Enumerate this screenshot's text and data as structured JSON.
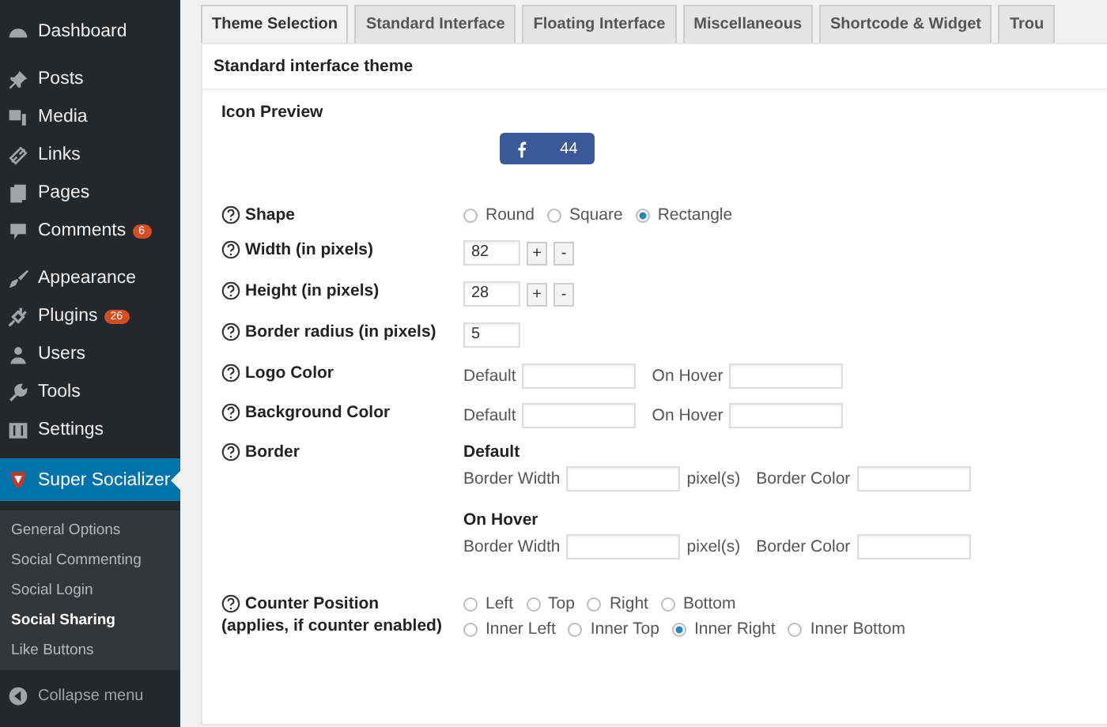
{
  "sidebar": {
    "groups": [
      [
        {
          "label": "Dashboard",
          "selected": false
        }
      ],
      [
        {
          "label": "Posts",
          "selected": false
        },
        {
          "label": "Media",
          "selected": false
        },
        {
          "label": "Links",
          "selected": false
        },
        {
          "label": "Pages",
          "selected": false
        },
        {
          "label": "Comments",
          "badge": "6",
          "selected": false
        }
      ],
      [
        {
          "label": "Appearance",
          "selected": false
        },
        {
          "label": "Plugins",
          "badge": "26",
          "selected": false
        },
        {
          "label": "Users",
          "selected": false
        },
        {
          "label": "Tools",
          "selected": false
        },
        {
          "label": "Settings",
          "selected": false
        }
      ],
      [
        {
          "label": "Super Socializer",
          "selected": true
        }
      ]
    ],
    "submenu": [
      {
        "label": "General Options",
        "selected": false
      },
      {
        "label": "Social Commenting",
        "selected": false
      },
      {
        "label": "Social Login",
        "selected": false
      },
      {
        "label": "Social Sharing",
        "selected": true
      },
      {
        "label": "Like Buttons",
        "selected": false
      }
    ],
    "collapse": "Collapse menu"
  },
  "tabs": [
    {
      "label": "Theme Selection",
      "selected": true
    },
    {
      "label": "Standard Interface",
      "selected": false
    },
    {
      "label": "Floating Interface",
      "selected": false
    },
    {
      "label": "Miscellaneous",
      "selected": false
    },
    {
      "label": "Shortcode & Widget",
      "selected": false
    },
    {
      "label": "Trou",
      "selected": false
    }
  ],
  "panel": {
    "title": "Standard interface theme",
    "preview_label": "Icon Preview",
    "preview_count": "44",
    "rows": [
      {
        "kind": "radio",
        "label": "Shape",
        "options": [
          [
            {
              "label": "Round",
              "selected": false
            },
            {
              "label": "Square",
              "selected": false
            },
            {
              "label": "Rectangle",
              "selected": true
            }
          ]
        ]
      },
      {
        "kind": "number",
        "label": "Width (in pixels)",
        "value": "82",
        "plus": "+",
        "minus": "-"
      },
      {
        "kind": "number",
        "label": "Height (in pixels)",
        "value": "28",
        "plus": "+",
        "minus": "-"
      },
      {
        "kind": "text",
        "label": "Border radius (in pixels)",
        "value": "5"
      },
      {
        "kind": "colors",
        "label": "Logo Color",
        "default": "Default",
        "hover": "On Hover"
      },
      {
        "kind": "colors",
        "label": "Background Color",
        "default": "Default",
        "hover": "On Hover"
      },
      {
        "kind": "border",
        "label": "Border",
        "sections": [
          {
            "title": "Default",
            "width": "Border Width",
            "unit": "pixel(s)",
            "color_label": "Border Color"
          },
          {
            "title": "On Hover",
            "width": "Border Width",
            "unit": "pixel(s)",
            "color_label": "Border Color"
          }
        ]
      },
      {
        "kind": "radio",
        "label": "Counter Position",
        "note": "(applies, if counter enabled)",
        "options": [
          [
            {
              "label": "Left",
              "selected": false
            },
            {
              "label": "Top",
              "selected": false
            },
            {
              "label": "Right",
              "selected": false
            },
            {
              "label": "Bottom",
              "selected": false
            }
          ],
          [
            {
              "label": "Inner Left",
              "selected": false
            },
            {
              "label": "Inner Top",
              "selected": false
            },
            {
              "label": "Inner Right",
              "selected": true
            },
            {
              "label": "Inner Bottom",
              "selected": false
            }
          ]
        ]
      }
    ]
  }
}
